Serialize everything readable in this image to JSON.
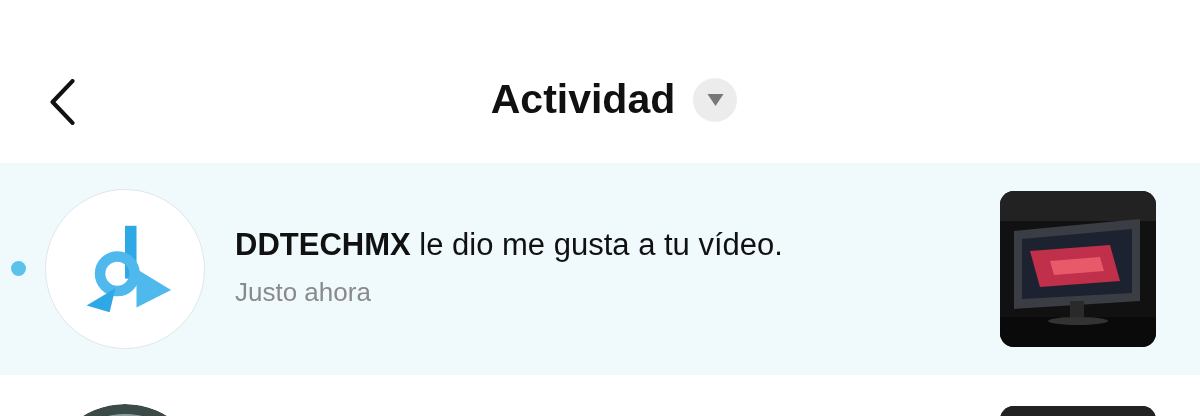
{
  "header": {
    "title": "Actividad",
    "filter_open": false
  },
  "notifications": [
    {
      "unread": true,
      "avatar": {
        "kind": "logo"
      },
      "message": "**DDTECHMX** le dio me gusta a tu vídeo.",
      "time": "Justo ahora"
    },
    {
      "unread": false
    }
  ]
}
